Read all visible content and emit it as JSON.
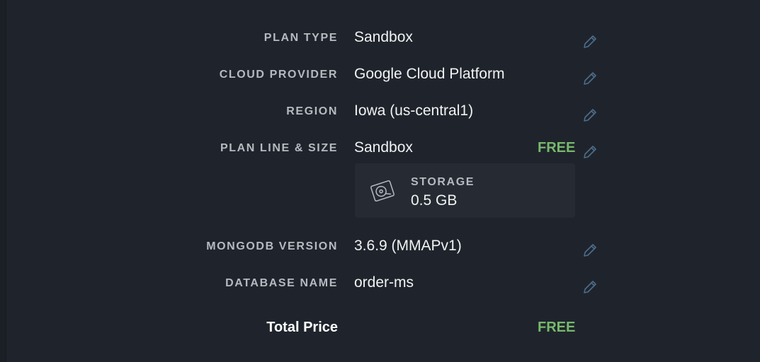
{
  "summary": {
    "rows": [
      {
        "label": "PLAN TYPE",
        "value": "Sandbox"
      },
      {
        "label": "CLOUD PROVIDER",
        "value": "Google Cloud Platform"
      },
      {
        "label": "REGION",
        "value": "Iowa (us-central1)"
      },
      {
        "label": "PLAN LINE & SIZE",
        "value": "Sandbox",
        "price": "FREE"
      },
      {
        "label": "MONGODB VERSION",
        "value": "3.6.9 (MMAPv1)"
      },
      {
        "label": "DATABASE NAME",
        "value": "order-ms"
      }
    ],
    "storage": {
      "label": "STORAGE",
      "value": "0.5 GB",
      "icon": "hard-drive-icon"
    },
    "total": {
      "label": "Total Price",
      "value": "FREE"
    }
  },
  "colors": {
    "background": "#1f242c",
    "label": "#b6bac0",
    "value": "#f1f2f3",
    "free": "#78b86c",
    "edit_icon": "#4d6d8a",
    "card": "#262b33"
  },
  "icons": {
    "edit": "pencil-icon"
  }
}
